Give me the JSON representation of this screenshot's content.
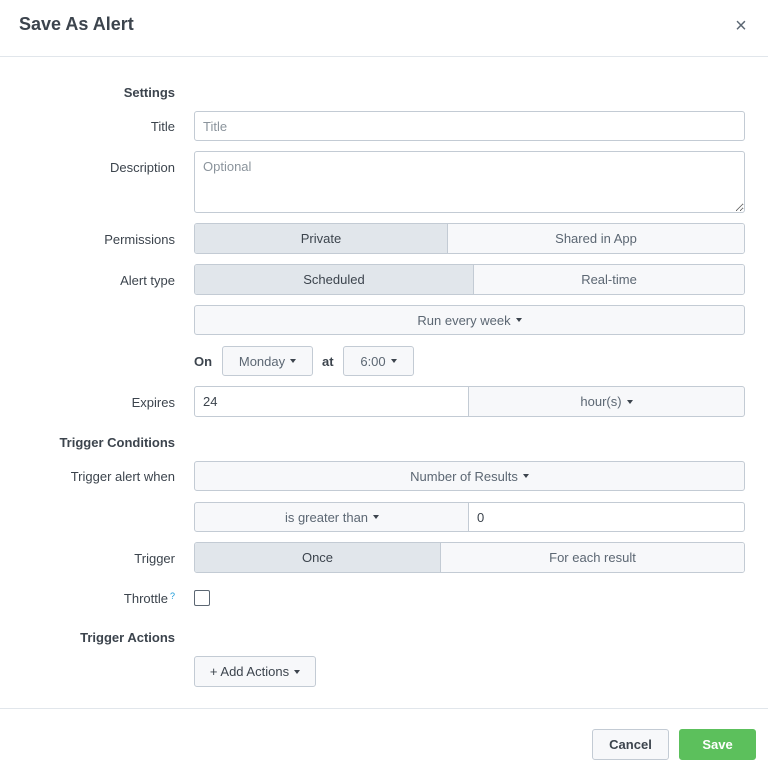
{
  "dialog": {
    "title": "Save As Alert",
    "close": "×"
  },
  "settings": {
    "heading": "Settings",
    "title_label": "Title",
    "title_placeholder": "Title",
    "description_label": "Description",
    "description_placeholder": "Optional",
    "permissions_label": "Permissions",
    "permissions_options": [
      "Private",
      "Shared in App"
    ],
    "permissions_selected": "Private",
    "alert_type_label": "Alert type",
    "alert_type_options": [
      "Scheduled",
      "Real-time"
    ],
    "alert_type_selected": "Scheduled",
    "schedule": "Run every week",
    "on_label": "On",
    "day": "Monday",
    "at_label": "at",
    "time": "6:00",
    "expires_label": "Expires",
    "expires_value": "24",
    "expires_unit": "hour(s)"
  },
  "trigger": {
    "heading": "Trigger Conditions",
    "when_label": "Trigger alert when",
    "when_value": "Number of Results",
    "comparison": "is greater than",
    "threshold": "0",
    "trigger_label": "Trigger",
    "trigger_options": [
      "Once",
      "For each result"
    ],
    "trigger_selected": "Once",
    "throttle_label": "Throttle",
    "throttle_help": "?",
    "throttle_checked": false
  },
  "actions": {
    "heading": "Trigger Actions",
    "add_label": "+ Add Actions"
  },
  "footer": {
    "cancel": "Cancel",
    "save": "Save"
  },
  "colors": {
    "accent_save": "#5cc05c",
    "help_link": "#1a9ad8",
    "border": "#c3cbd4"
  },
  "icons": {
    "close": "close-icon",
    "caret": "caret-down-icon"
  }
}
